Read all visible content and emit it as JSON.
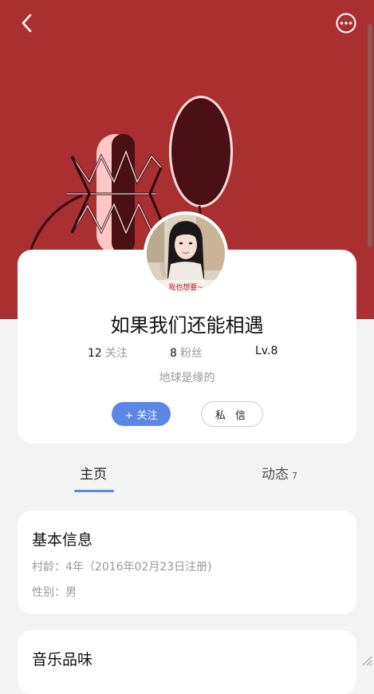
{
  "header": {
    "back_icon": "chevron-left-icon",
    "more_icon": "more-circle-icon",
    "background_color": "#a92f31"
  },
  "profile": {
    "avatar_caption": "我也想要~",
    "name": "如果我们还能相遇",
    "stats": {
      "following_count": "12",
      "following_label": "关注",
      "followers_count": "8",
      "followers_label": "粉丝",
      "level": "Lv.8"
    },
    "bio": "地球是缘的",
    "follow_button": "+ 关注",
    "message_button": "私 信"
  },
  "tabs": {
    "home": "主页",
    "feed": "动态",
    "feed_count": "7"
  },
  "basic_info": {
    "title": "基本信息",
    "village_age": "村龄：4年（2016年02月23日注册)",
    "gender": "性别：男"
  },
  "music_taste": {
    "title": "音乐品味"
  },
  "colors": {
    "accent": "#5b86e5",
    "hero": "#a92f31"
  }
}
